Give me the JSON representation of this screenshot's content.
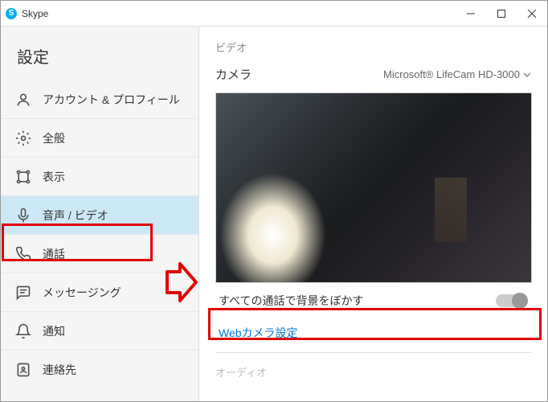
{
  "app": {
    "title": "Skype"
  },
  "sidebar": {
    "title": "設定",
    "items": [
      {
        "label": "アカウント & プロフィール"
      },
      {
        "label": "全般"
      },
      {
        "label": "表示"
      },
      {
        "label": "音声 / ビデオ"
      },
      {
        "label": "通話"
      },
      {
        "label": "メッセージング"
      },
      {
        "label": "通知"
      },
      {
        "label": "連絡先"
      }
    ]
  },
  "main": {
    "section_video": "ビデオ",
    "camera_label": "カメラ",
    "camera_value": "Microsoft® LifeCam HD-3000",
    "blur_label": "すべての通話で背景をぼかす",
    "webcam_link": "Webカメラ設定",
    "section_audio": "オーディオ"
  }
}
